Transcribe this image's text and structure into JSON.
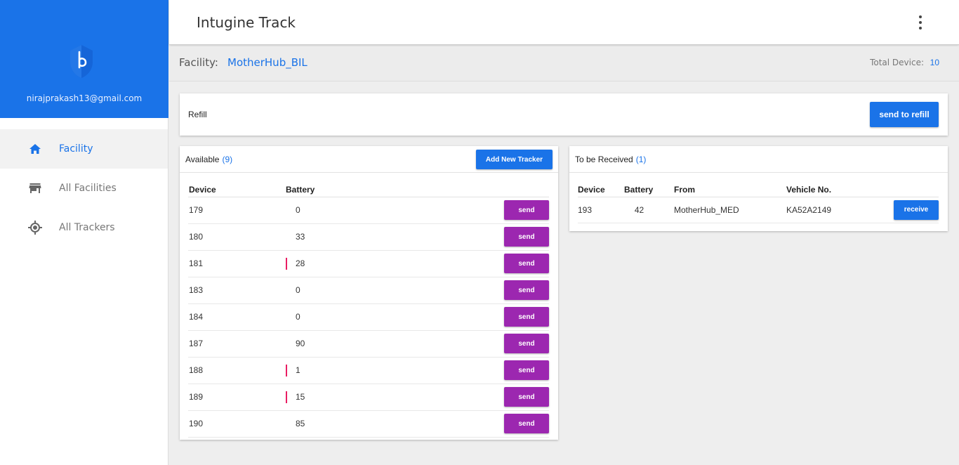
{
  "user": {
    "email": "nirajprakash13@gmail.com"
  },
  "sidebar": {
    "items": [
      {
        "label": "Facility",
        "icon": "home-icon"
      },
      {
        "label": "All Facilities",
        "icon": "store-icon"
      },
      {
        "label": "All Trackers",
        "icon": "gps-target-icon"
      }
    ]
  },
  "header": {
    "title": "Intugine Track"
  },
  "facility": {
    "label": "Facility:",
    "name": "MotherHub_BIL",
    "total_label": "Total Device:",
    "total_value": "10"
  },
  "refill": {
    "label": "Refill",
    "button": "send to refill"
  },
  "available": {
    "title": "Available",
    "count": "(9)",
    "add_button": "Add New Tracker",
    "columns": [
      "Device",
      "Battery"
    ],
    "send_label": "send",
    "rows": [
      {
        "device": "179",
        "battery": "0",
        "low": false
      },
      {
        "device": "180",
        "battery": "33",
        "low": false
      },
      {
        "device": "181",
        "battery": "28",
        "low": true
      },
      {
        "device": "183",
        "battery": "0",
        "low": false
      },
      {
        "device": "184",
        "battery": "0",
        "low": false
      },
      {
        "device": "187",
        "battery": "90",
        "low": false
      },
      {
        "device": "188",
        "battery": "1",
        "low": true
      },
      {
        "device": "189",
        "battery": "15",
        "low": true
      },
      {
        "device": "190",
        "battery": "85",
        "low": false
      }
    ]
  },
  "to_receive": {
    "title": "To be Received",
    "count": "(1)",
    "columns": [
      "Device",
      "Battery",
      "From",
      "Vehicle No."
    ],
    "receive_label": "receive",
    "rows": [
      {
        "device": "193",
        "battery": "42",
        "from": "MotherHub_MED",
        "vehicle": "KA52A2149"
      }
    ]
  },
  "colors": {
    "primary": "#1a73e8",
    "send": "#9c27b0",
    "low_battery": "#e91e63"
  }
}
